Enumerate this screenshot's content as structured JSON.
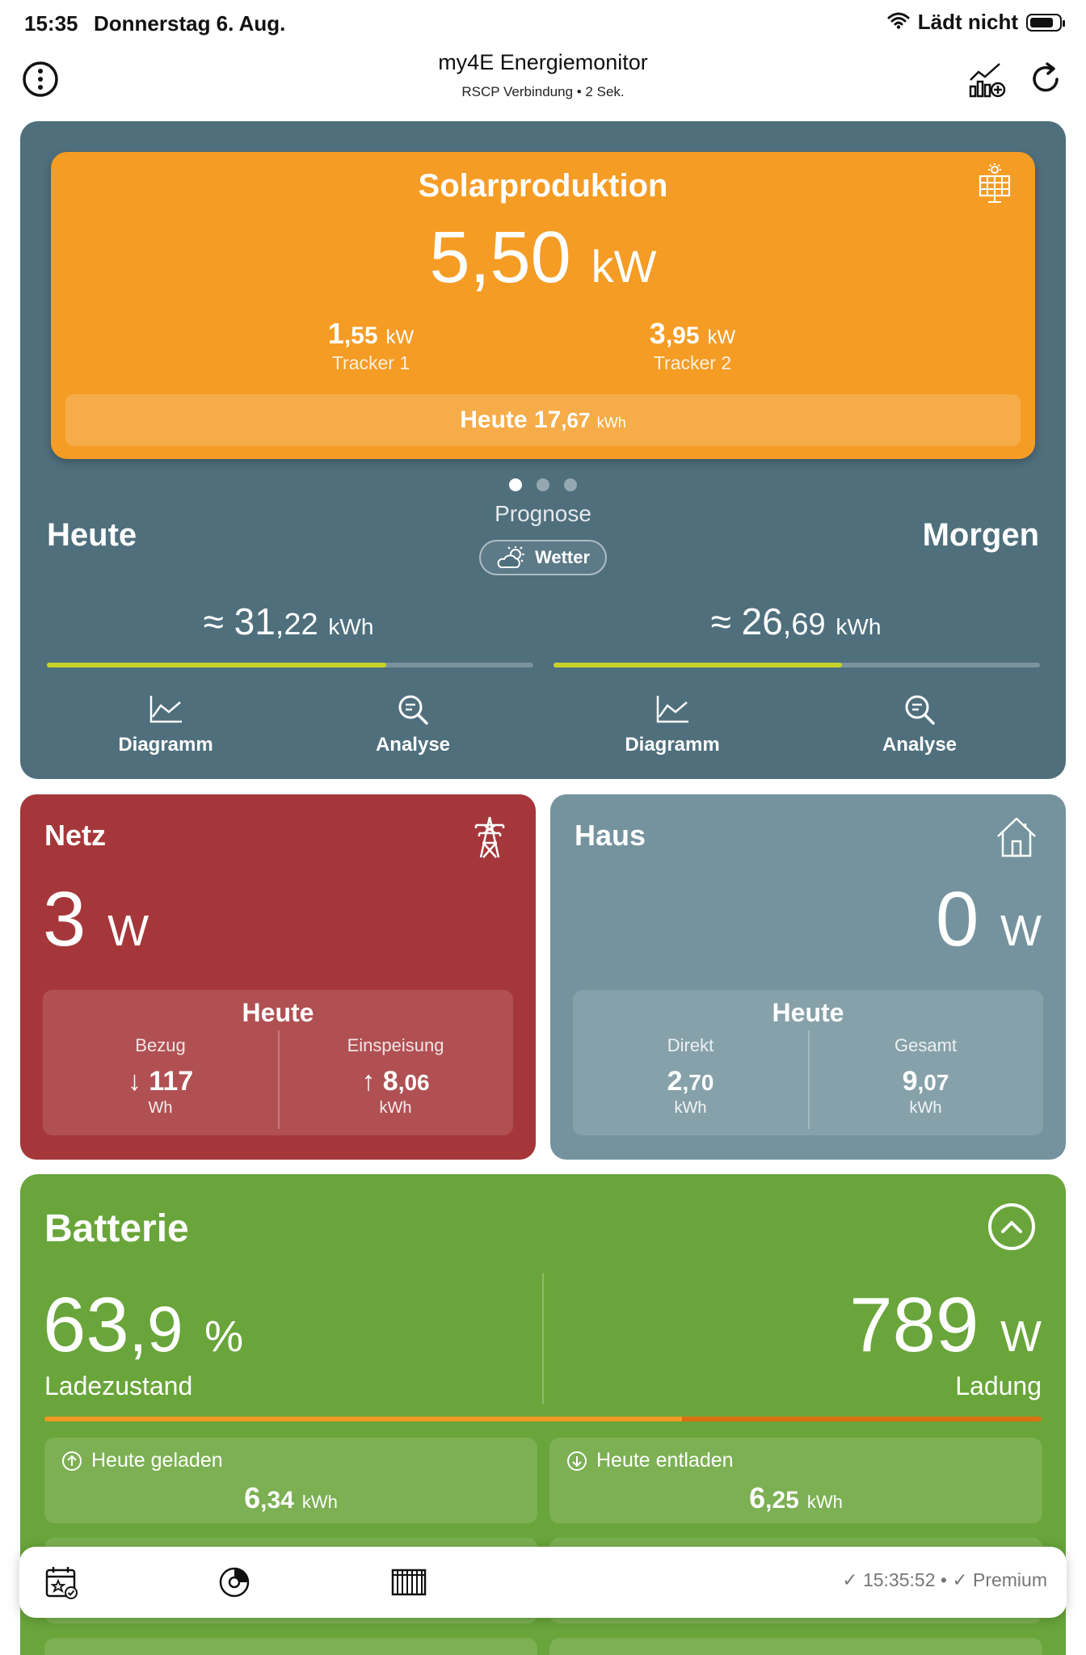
{
  "status_bar": {
    "time": "15:35",
    "date": "Donnerstag 6. Aug.",
    "charging": "Lädt nicht"
  },
  "nav": {
    "title": "my4E Energiemonitor",
    "subtitle": "RSCP Verbindung • 2 Sek.",
    "icons": [
      "info-icon",
      "chart-add-icon",
      "refresh-icon"
    ]
  },
  "solar": {
    "title": "Solarproduktion",
    "value_int": "5",
    "value_dec": ",50",
    "unit": "kW",
    "tracker1": {
      "int": "1",
      "dec": ",55",
      "unit": "kW",
      "label": "Tracker 1"
    },
    "tracker2": {
      "int": "3",
      "dec": ",95",
      "unit": "kW",
      "label": "Tracker 2"
    },
    "today_label": "Heute 17",
    "today_dec": ",67",
    "today_unit": "kWh",
    "icon": "solar-panel-icon",
    "color": "#f59c25"
  },
  "forecast": {
    "label": "Prognose",
    "weather_button": "Wetter",
    "page_count": 3,
    "active_page": 0,
    "today": {
      "label": "Heute",
      "value_int": "≈ 31",
      "value_dec": ",22",
      "unit": "kWh",
      "progress": 0.697,
      "diagram": "Diagramm",
      "analysis": "Analyse"
    },
    "tomorrow": {
      "label": "Morgen",
      "value_int": "≈ 26",
      "value_dec": ",69",
      "unit": "kWh",
      "progress": 0.593,
      "diagram": "Diagramm",
      "analysis": "Analyse"
    }
  },
  "netz": {
    "title": "Netz",
    "value": "3",
    "unit": "W",
    "today": "Heute",
    "left_label": "Bezug",
    "left_value": "↓ 117",
    "left_unit": "Wh",
    "right_label": "Einspeisung",
    "right_value_int": "↑ 8",
    "right_value_dec": ",06",
    "right_unit": "kWh",
    "icon": "power-tower-icon",
    "color": "#a5373a"
  },
  "haus": {
    "title": "Haus",
    "value": "0",
    "unit": "W",
    "today": "Heute",
    "left_label": "Direkt",
    "left_value_int": "2",
    "left_value_dec": ",70",
    "left_unit": "kWh",
    "right_label": "Gesamt",
    "right_value_int": "9",
    "right_value_dec": ",07",
    "right_unit": "kWh",
    "icon": "house-icon",
    "color": "#74939e"
  },
  "batterie": {
    "title": "Batterie",
    "soc_int": "63",
    "soc_dec": ",9",
    "soc_unit": "%",
    "soc_label": "Ladezustand",
    "soc_fraction": 0.639,
    "power": "789",
    "power_unit": "W",
    "power_label": "Ladung",
    "charged_label": "Heute geladen",
    "charged_int": "6",
    "charged_dec": ",34",
    "charged_unit": "kWh",
    "discharged_label": "Heute entladen",
    "discharged_int": "6",
    "discharged_dec": ",25",
    "discharged_unit": "kWh",
    "color": "#69a53a"
  },
  "toolbar": {
    "status": "✓ 15:35:52 • ✓ Premium",
    "icons": [
      "calendar-star-icon",
      "pie-chart-icon",
      "grid-icon"
    ]
  }
}
